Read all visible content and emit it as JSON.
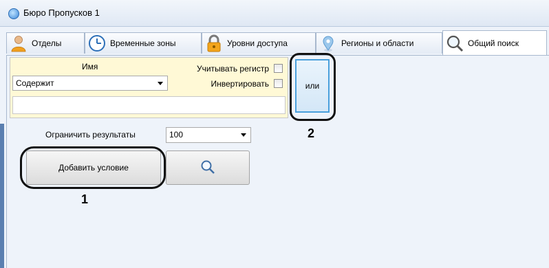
{
  "window": {
    "title": "Бюро Пропусков 1"
  },
  "tabs": [
    {
      "label": "Отделы",
      "icon": "person-icon"
    },
    {
      "label": "Временные зоны",
      "icon": "clock-icon"
    },
    {
      "label": "Уровни доступа",
      "icon": "padlock-icon"
    },
    {
      "label": "Регионы и области",
      "icon": "map-pin-icon"
    },
    {
      "label": "Общий поиск",
      "icon": "magnifier-icon",
      "active": true
    }
  ],
  "condition": {
    "field_label": "Имя",
    "operator": "Содержит",
    "case_sensitive_label": "Учитывать регистр",
    "invert_label": "Инвертировать",
    "value": ""
  },
  "or_button": {
    "label": "или"
  },
  "limit": {
    "label": "Ограничить результаты",
    "value": "100"
  },
  "add_condition_button": {
    "label": "Добавить условие"
  },
  "search_button": {
    "icon": "search-icon"
  },
  "callouts": {
    "one": "1",
    "two": "2"
  },
  "colors": {
    "accent": "#4aa0dc",
    "panel": "#eef3fa",
    "condition_bg": "#fff9d6"
  }
}
